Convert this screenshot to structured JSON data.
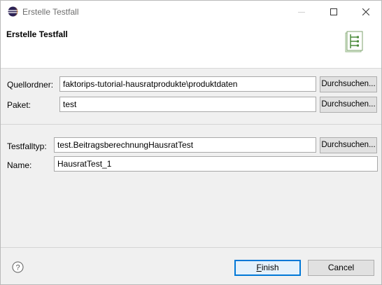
{
  "window": {
    "title": "Erstelle Testfall"
  },
  "header": {
    "title": "Erstelle Testfall",
    "icon": "testcase-wizard-icon"
  },
  "form": {
    "source_folder": {
      "label": "Quellordner:",
      "value": "faktorips-tutorial-hausratprodukte\\produktdaten",
      "browse_label": "Durchsuchen..."
    },
    "package": {
      "label": "Paket:",
      "value": "test",
      "browse_label": "Durchsuchen..."
    },
    "test_case_type": {
      "label": "Testfalltyp:",
      "value": "test.BeitragsberechnungHausratTest",
      "browse_label": "Durchsuchen..."
    },
    "name": {
      "label": "Name:",
      "value": "HausratTest_1"
    }
  },
  "footer": {
    "help_icon": "help-icon",
    "finish_label": "Finish",
    "cancel_label": "Cancel"
  },
  "colors": {
    "default_button_border": "#0078d7",
    "default_button_bg": "#e5f1fb",
    "header_bg": "#ffffff",
    "dialog_bg": "#f0f0f0"
  }
}
